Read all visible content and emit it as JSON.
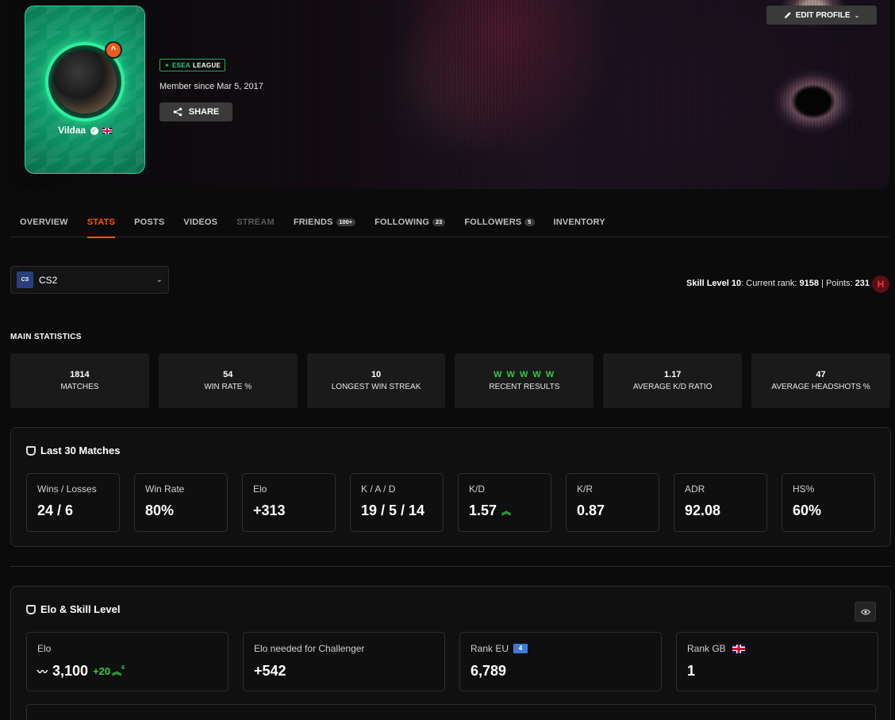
{
  "header": {
    "username": "Vildaa",
    "level": "^",
    "esea_prefix": "ESEA",
    "esea_suffix": "LEAGUE",
    "member_since": "Member since Mar 5, 2017",
    "share_label": "SHARE",
    "edit_profile_label": "EDIT PROFILE"
  },
  "tabs": [
    {
      "label": "OVERVIEW"
    },
    {
      "label": "STATS"
    },
    {
      "label": "POSTS"
    },
    {
      "label": "VIDEOS"
    },
    {
      "label": "STREAM"
    },
    {
      "label": "FRIENDS",
      "count": "100+"
    },
    {
      "label": "FOLLOWING",
      "count": "23"
    },
    {
      "label": "FOLLOWERS",
      "count": "5"
    },
    {
      "label": "INVENTORY"
    }
  ],
  "game_select": {
    "logo": "CS",
    "value": "CS2"
  },
  "skill": {
    "level_label": "Skill Level 10",
    "rank_label": ": Current rank: ",
    "rank": "9158",
    "points_label": " | Points: ",
    "points": "231",
    "icon_glyph": "H"
  },
  "main_statistics": {
    "heading": "MAIN STATISTICS",
    "items": [
      {
        "value": "1814",
        "label": "MATCHES"
      },
      {
        "value": "54",
        "label": "WIN RATE %"
      },
      {
        "value": "10",
        "label": "LONGEST WIN STREAK"
      },
      {
        "value": "W W W W W",
        "label": "RECENT RESULTS"
      },
      {
        "value": "1.17",
        "label": "AVERAGE K/D RATIO"
      },
      {
        "value": "47",
        "label": "AVERAGE HEADSHOTS %"
      }
    ]
  },
  "last30": {
    "title": "Last 30 Matches",
    "metrics": [
      {
        "label": "Wins / Losses",
        "value": "24 / 6"
      },
      {
        "label": "Win Rate",
        "value": "80%"
      },
      {
        "label": "Elo",
        "value": "+313"
      },
      {
        "label": "K / A / D",
        "value": "19 / 5 / 14"
      },
      {
        "label": "K/D",
        "value": "1.57",
        "trend": "up"
      },
      {
        "label": "K/R",
        "value": "0.87"
      },
      {
        "label": "ADR",
        "value": "92.08"
      },
      {
        "label": "HS%",
        "value": "60%"
      }
    ]
  },
  "elo_section": {
    "title": "Elo & Skill Level",
    "cards": [
      {
        "label": "Elo",
        "value": "3,100",
        "delta": "+20",
        "delta_sup": "6"
      },
      {
        "label": "Elo needed for Challenger",
        "value": "+542"
      },
      {
        "label": "Rank EU",
        "badge": "4",
        "value": "6,789"
      },
      {
        "label": "Rank GB",
        "value": "1"
      }
    ]
  },
  "colors": {
    "accent": "#ff5500",
    "positive": "#2ecc40",
    "card_green": "#0f9a6a"
  },
  "icons": {
    "share": "share-icon",
    "edit": "pencil-icon",
    "eye": "eye-icon",
    "mask": "mask-icon"
  }
}
